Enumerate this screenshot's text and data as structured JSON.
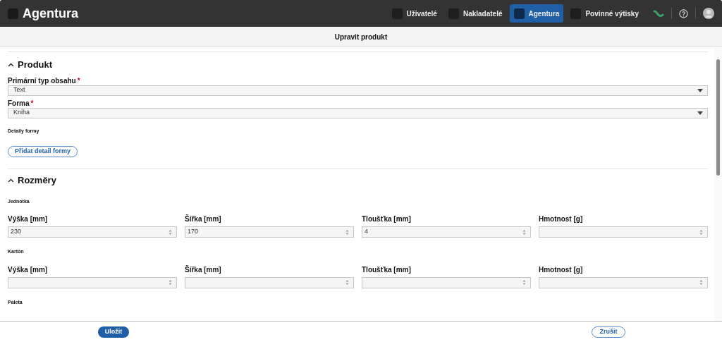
{
  "app": {
    "title": "Agentura"
  },
  "nav": [
    {
      "label": "Uživatelé",
      "selected": false
    },
    {
      "label": "Nakladatelé",
      "selected": false
    },
    {
      "label": "Agentura",
      "selected": true
    },
    {
      "label": "Povinné výtisky",
      "selected": false
    }
  ],
  "dialog_title": "Upravit produkt",
  "product_section": {
    "title": "Produkt",
    "expanded": true,
    "selects": [
      {
        "label": "Primární typ obsahu",
        "required_mark": "*",
        "value": "Text"
      },
      {
        "label": "Forma",
        "required_mark": "*",
        "value": "Kniha"
      }
    ],
    "details_label": "Detaily formy",
    "add_button": "Přidat detail formy"
  },
  "dimensions_section": {
    "title": "Rozměry",
    "expanded": true,
    "groups": [
      {
        "title": "Jednotka",
        "fields": [
          {
            "label": "Výška [mm]",
            "value": "230"
          },
          {
            "label": "Šířka [mm]",
            "value": "170"
          },
          {
            "label": "Tloušťka [mm]",
            "value": "4"
          },
          {
            "label": "Hmotnost [g]"
          }
        ]
      },
      {
        "title": "Kartón",
        "fields": [
          {
            "label": "Výška [mm]"
          },
          {
            "label": "Šířka [mm]"
          },
          {
            "label": "Tloušťka [mm]"
          },
          {
            "label": "Hmotnost [g]"
          }
        ]
      },
      {
        "title": "Paleta"
      }
    ]
  },
  "footer": {
    "save": "Uložit",
    "cancel": "Zrušit"
  }
}
